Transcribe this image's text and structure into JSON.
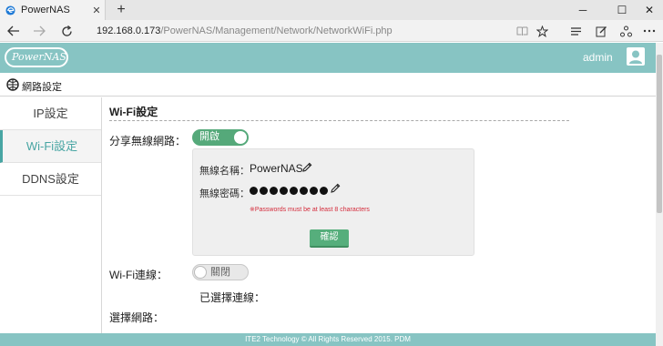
{
  "browser": {
    "tab_title": "PowerNAS",
    "close_tab_glyph": "✕",
    "new_tab_glyph": "+",
    "address_host": "192.168.0.173",
    "address_path": "/PowerNAS/Management/Network/NetworkWiFi.php",
    "window_controls": {
      "minimize": "─",
      "maximize": "☐",
      "close": "✕"
    }
  },
  "header": {
    "logo_text": "PowerNAS",
    "user_name": "admin",
    "accent_color": "#87c4c3"
  },
  "breadcrumb": {
    "title": "網路設定"
  },
  "sidebar": {
    "items": [
      {
        "label": "IP設定",
        "active": false
      },
      {
        "label": "Wi-Fi設定",
        "active": true
      },
      {
        "label": "DDNS設定",
        "active": false
      }
    ]
  },
  "main": {
    "section_title": "Wi-Fi設定",
    "share_label": "分享無線網路：",
    "share_toggle": {
      "label": "開啟",
      "state": "on"
    },
    "wifi_box": {
      "name_label": "無線名稱：",
      "name_value": "PowerNAS",
      "password_label": "無線密碼：",
      "password_dot_count": 8,
      "error_text": "※Passwords must be at least 8 characters",
      "confirm_label": "確認"
    },
    "wifi_conn_label": "Wi-Fi連線：",
    "wifi_conn_toggle": {
      "label": "關閉",
      "state": "off"
    },
    "selected_conn_label": "已選擇連線：",
    "select_network_label": "選擇網路："
  },
  "footer": {
    "text": "ITE2 Technology © All Rights Reserved 2015. PDM"
  },
  "colors": {
    "toggle_on": "#55a97a",
    "error": "#d42a3a",
    "sidebar_active": "#48a5a3"
  }
}
